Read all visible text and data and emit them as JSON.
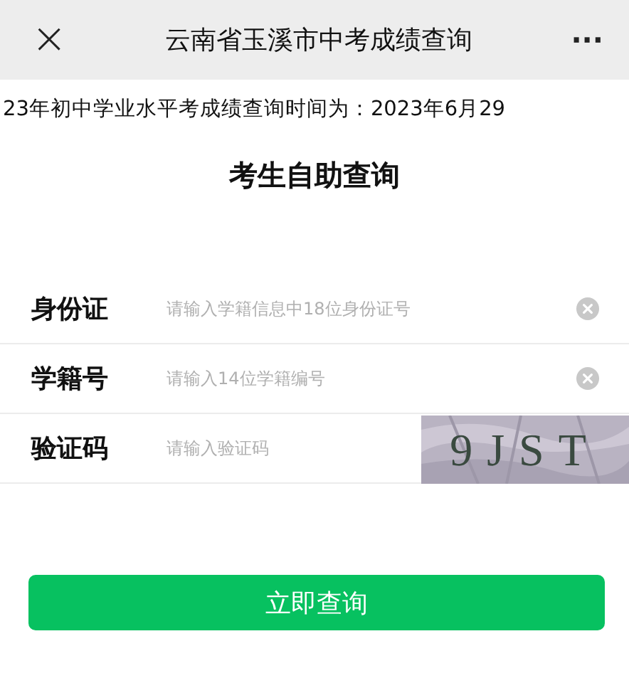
{
  "nav_bar": {
    "close": "×",
    "title": "云南省玉溪市中考成绩查询",
    "more": "···"
  },
  "notice": "23年初中学业水平考成绩查询时间为：2023年6月29",
  "heading": "考生自助查询",
  "fields": [
    {
      "kind": "clearable",
      "label": "身份证",
      "placeholder": "请输入学籍信息中18位身份证号"
    },
    {
      "kind": "clearable",
      "label": "学籍号",
      "placeholder": "请输入14位学籍编号"
    },
    {
      "kind": "captcha",
      "label": "验证码",
      "placeholder": "请输入验证码",
      "captcha": "9JST"
    }
  ],
  "submit_button": "立即查询"
}
